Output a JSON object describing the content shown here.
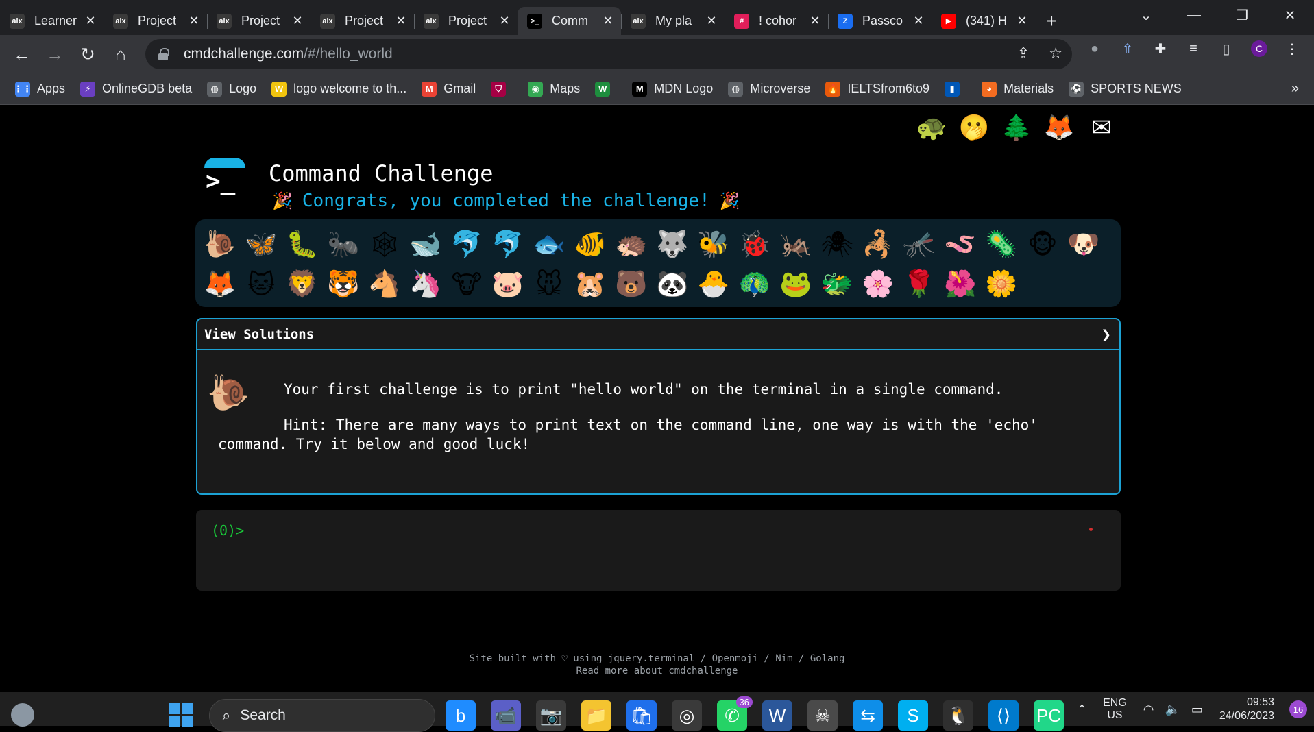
{
  "browser": {
    "tabs": [
      {
        "title": "Learner",
        "icon": "alx-icon",
        "color": "#3a3a3a",
        "glyph": "alx"
      },
      {
        "title": "Project",
        "icon": "alx-icon",
        "color": "#3a3a3a",
        "glyph": "alx"
      },
      {
        "title": "Project",
        "icon": "alx-icon",
        "color": "#3a3a3a",
        "glyph": "alx"
      },
      {
        "title": "Project",
        "icon": "alx-icon",
        "color": "#3a3a3a",
        "glyph": "alx"
      },
      {
        "title": "Project",
        "icon": "alx-icon",
        "color": "#3a3a3a",
        "glyph": "alx"
      },
      {
        "title": "Comm",
        "icon": "terminal-icon",
        "color": "#000000",
        "glyph": ">_",
        "active": true
      },
      {
        "title": "My pla",
        "icon": "alx-icon",
        "color": "#3a3a3a",
        "glyph": "alx"
      },
      {
        "title": "! cohor",
        "icon": "slack-icon",
        "color": "#e01e5a",
        "glyph": "#"
      },
      {
        "title": "Passco",
        "icon": "zoom-icon",
        "color": "#1a6df0",
        "glyph": "Z"
      },
      {
        "title": "(341) H",
        "icon": "youtube-icon",
        "color": "#ff0000",
        "glyph": "▶"
      }
    ],
    "address": {
      "host": "cmdchallenge.com",
      "path": "/#/hello_world"
    },
    "bookmarks": [
      {
        "label": "Apps",
        "icon": "apps-grid-icon",
        "color": "#4285f4",
        "glyph": "⋮⋮"
      },
      {
        "label": "OnlineGDB beta",
        "icon": "onlinegdb-icon",
        "color": "#6a3fc1",
        "glyph": "⚡"
      },
      {
        "label": "Logo",
        "icon": "globe-icon",
        "color": "#5f6368",
        "glyph": "◍"
      },
      {
        "label": "logo welcome to th...",
        "icon": "w-logo-icon",
        "color": "#f1c40f",
        "glyph": "W"
      },
      {
        "label": "Gmail",
        "icon": "gmail-icon",
        "color": "#ea4335",
        "glyph": "M"
      },
      {
        "label": "",
        "icon": "fc-barcelona-icon",
        "color": "#a50044",
        "glyph": "⛉"
      },
      {
        "label": "Maps",
        "icon": "maps-icon",
        "color": "#34a853",
        "glyph": "◉"
      },
      {
        "label": "",
        "icon": "w-green-icon",
        "color": "#1e8e3e",
        "glyph": "W"
      },
      {
        "label": "MDN Logo",
        "icon": "mdn-icon",
        "color": "#000000",
        "glyph": "M"
      },
      {
        "label": "Microverse",
        "icon": "globe-icon",
        "color": "#5f6368",
        "glyph": "◍"
      },
      {
        "label": "IELTSfrom6to9",
        "icon": "fire-icon",
        "color": "#e8590c",
        "glyph": "🔥"
      },
      {
        "label": "",
        "icon": "ukraine-flag-icon",
        "color": "#0057b7",
        "glyph": "▮"
      },
      {
        "label": "Materials",
        "icon": "materials-icon",
        "color": "#f36c21",
        "glyph": "◕"
      },
      {
        "label": "SPORTS NEWS",
        "icon": "soccer-ball-icon",
        "color": "#5f6368",
        "glyph": "⚽"
      }
    ]
  },
  "page": {
    "top_icons": [
      "🐢",
      "🫢",
      "🌲",
      "🦊",
      "✉"
    ],
    "title": "Command Challenge",
    "congrats": "Congrats, you completed the challenge!",
    "party_glyph": "🎉",
    "animals": [
      "🐌",
      "🦋",
      "🐛",
      "🐜",
      "🕸",
      "🐋",
      "🐬",
      "🐬",
      "🐟",
      "🐠",
      "🦔",
      "🐺",
      "🐝",
      "🐞",
      "🦗",
      "🕷",
      "🦂",
      "🦟",
      "🪱",
      "🦠",
      "🐵",
      "🐶",
      "🦊",
      "🐱",
      "🦁",
      "🐯",
      "🐴",
      "🦄",
      "🐮",
      "🐷",
      "🐭",
      "🐹",
      "🐻",
      "🐼",
      "🐣",
      "🦚",
      "🐸",
      "🐲",
      "🌸",
      "🌹",
      "🌺",
      "🌼"
    ],
    "panel_header": "View Solutions",
    "chevron": "❯",
    "challenge_icon": "🐌",
    "challenge_text": "Your first challenge is to print \"hello world\" on the terminal in a single command.",
    "hint_text": "Hint: There are many ways to print text on the command line, one way is with the 'echo' command. Try it below and good luck!",
    "prompt": "(0)>",
    "footer_line1": "Site built with ♡ using jquery.terminal / Openmoji / Nim / Golang",
    "footer_line2": "Read more about cmdchallenge"
  },
  "taskbar": {
    "search": "Search",
    "apps": [
      {
        "icon": "bing-icon",
        "glyph": "b",
        "color": "#1f8cff"
      },
      {
        "icon": "teams-icon",
        "glyph": "📹",
        "color": "#5b5fc7"
      },
      {
        "icon": "camera-icon",
        "glyph": "📷",
        "color": "#3a3a3a"
      },
      {
        "icon": "file-explorer-icon",
        "glyph": "📁",
        "color": "#f4c430"
      },
      {
        "icon": "store-icon",
        "glyph": "🛍",
        "color": "#1f6feb"
      },
      {
        "icon": "chrome-icon",
        "glyph": "◎",
        "color": "#3a3a3a"
      },
      {
        "icon": "whatsapp-icon",
        "glyph": "✆",
        "color": "#25d366",
        "badge": "36"
      },
      {
        "icon": "word-icon",
        "glyph": "W",
        "color": "#2b579a"
      },
      {
        "icon": "game-icon",
        "glyph": "☠",
        "color": "#4a4a4a"
      },
      {
        "icon": "teamviewer-icon",
        "glyph": "⇆",
        "color": "#0e8ee9"
      },
      {
        "icon": "skype-icon",
        "glyph": "S",
        "color": "#00aff0"
      },
      {
        "icon": "linux-penguin-icon",
        "glyph": "🐧",
        "color": "#2f2f2f"
      },
      {
        "icon": "vscode-icon",
        "glyph": "⟨⟩",
        "color": "#007acc"
      },
      {
        "icon": "pycharm-icon",
        "glyph": "PC",
        "color": "#21d789"
      }
    ],
    "lang": "ENG",
    "region": "US",
    "time": "09:53",
    "date": "24/06/2023",
    "notifications": "16"
  }
}
